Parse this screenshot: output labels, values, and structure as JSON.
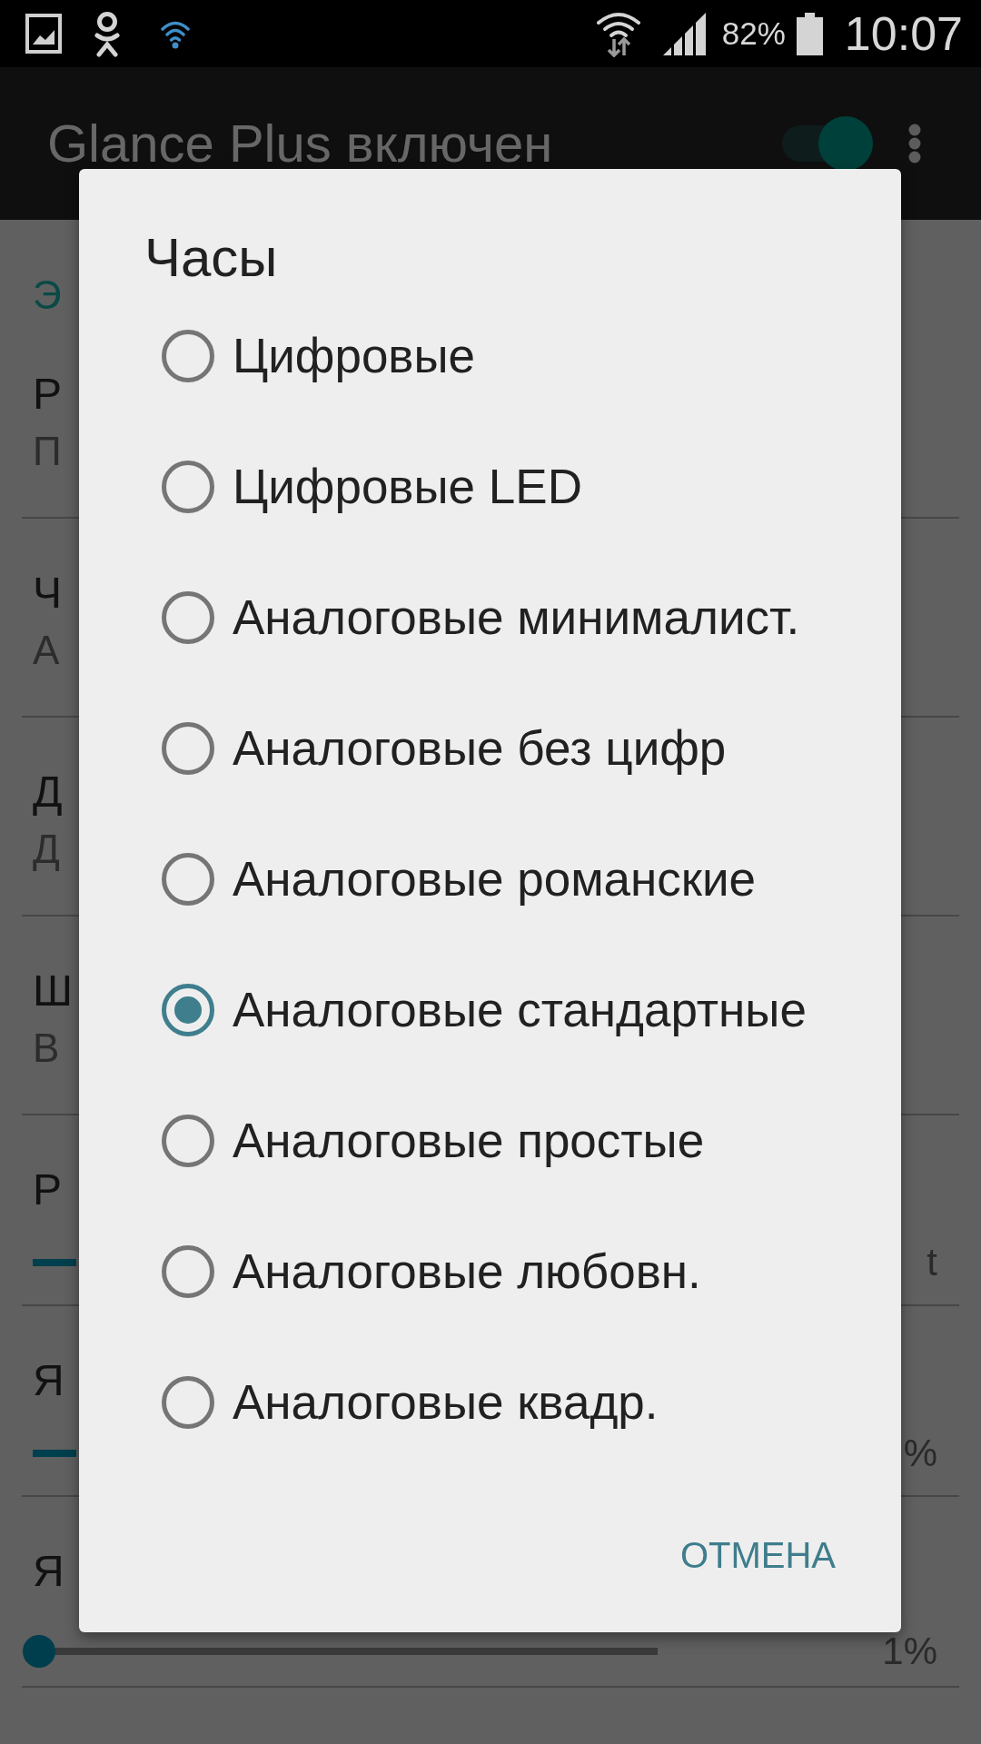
{
  "status_bar": {
    "battery": "82%",
    "time": "10:07"
  },
  "toolbar": {
    "title": "Glance Plus включен",
    "switch_on": true
  },
  "settings": {
    "section_header": "Э",
    "items": [
      {
        "kind": "text",
        "title": "Р",
        "summary": "П"
      },
      {
        "kind": "text",
        "title": "Ч",
        "summary": "А"
      },
      {
        "kind": "text",
        "title": "Д",
        "summary": "Д"
      },
      {
        "kind": "text",
        "title": "Ш",
        "summary": "В"
      },
      {
        "kind": "slider",
        "title": "Р",
        "value": "t"
      },
      {
        "kind": "slider",
        "title": "Я",
        "value": "%"
      },
      {
        "kind": "slider",
        "title": "Я",
        "value": "1%",
        "level": 0.01
      }
    ]
  },
  "dialog": {
    "title": "Часы",
    "options": [
      {
        "label": "Цифровые",
        "selected": false
      },
      {
        "label": "Цифровые LED",
        "selected": false
      },
      {
        "label": "Аналоговые минималист.",
        "selected": false
      },
      {
        "label": "Аналоговые без цифр",
        "selected": false
      },
      {
        "label": "Аналоговые романские",
        "selected": false
      },
      {
        "label": "Аналоговые стандартные",
        "selected": true
      },
      {
        "label": "Аналоговые простые",
        "selected": false
      },
      {
        "label": "Аналоговые любовн.",
        "selected": false
      },
      {
        "label": "Аналоговые квадр.",
        "selected": false
      }
    ],
    "buttons": [
      "ОТМЕНА"
    ]
  }
}
